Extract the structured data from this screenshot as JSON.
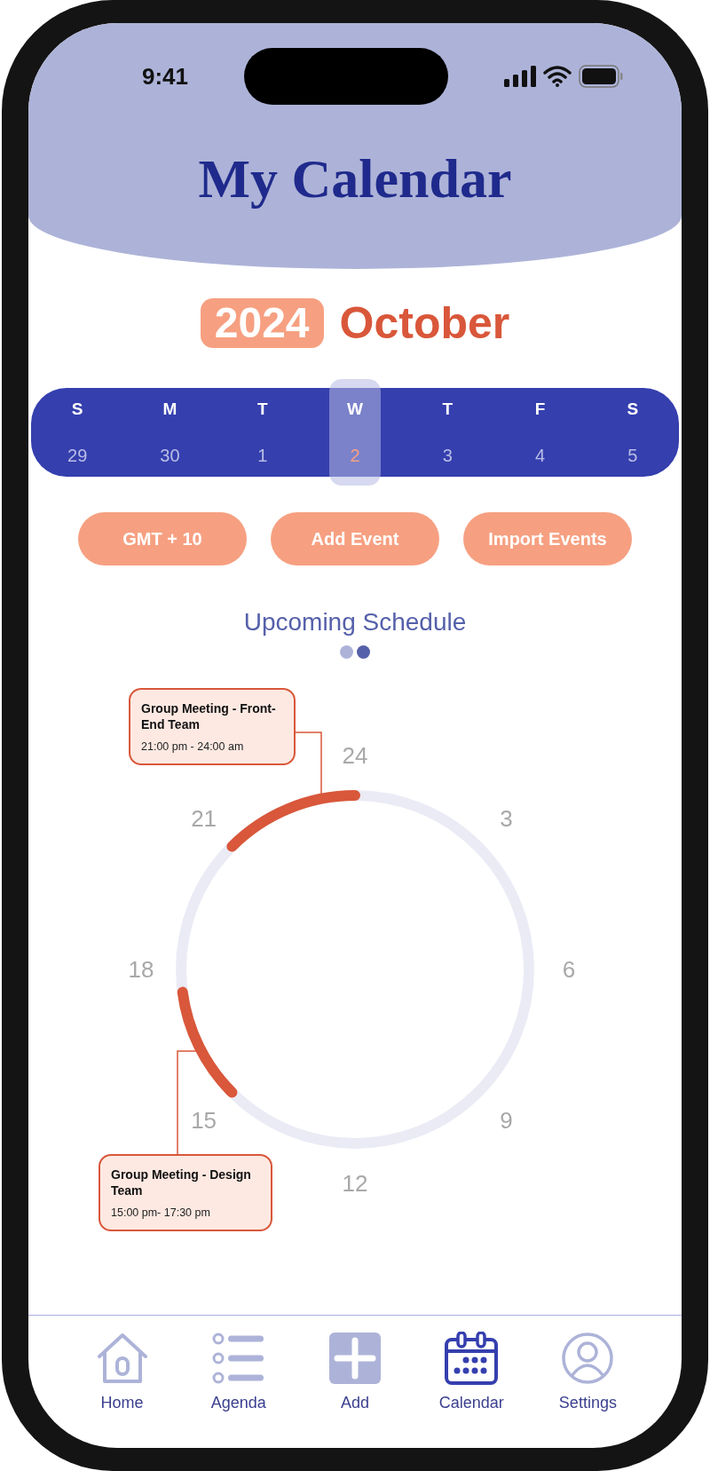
{
  "status_bar": {
    "time": "9:41"
  },
  "header": {
    "title": "My Calendar"
  },
  "month_header": {
    "year": "2024",
    "month": "October"
  },
  "week": [
    {
      "day": "S",
      "date": "29",
      "selected": false
    },
    {
      "day": "M",
      "date": "30",
      "selected": false
    },
    {
      "day": "T",
      "date": "1",
      "selected": false
    },
    {
      "day": "W",
      "date": "2",
      "selected": true
    },
    {
      "day": "T",
      "date": "3",
      "selected": false
    },
    {
      "day": "F",
      "date": "4",
      "selected": false
    },
    {
      "day": "S",
      "date": "5",
      "selected": false
    }
  ],
  "actions": [
    "GMT + 10",
    "Add Event",
    "Import Events"
  ],
  "schedule": {
    "title": "Upcoming Schedule",
    "pages": [
      {
        "selected": false
      },
      {
        "selected": true
      }
    ],
    "hour_labels": [
      "24",
      "3",
      "6",
      "9",
      "12",
      "15",
      "18",
      "21"
    ],
    "events": [
      {
        "title": "Group Meeting - Front-End Team",
        "time": "21:00 pm - 24:00 am"
      },
      {
        "title": "Group Meeting - Design Team",
        "time": "15:00 pm- 17:30 pm"
      }
    ]
  },
  "nav": [
    {
      "label": "Home",
      "selected": false
    },
    {
      "label": "Agenda",
      "selected": false
    },
    {
      "label": "Add",
      "selected": false
    },
    {
      "label": "Calendar",
      "selected": true
    },
    {
      "label": "Settings",
      "selected": false
    }
  ]
}
